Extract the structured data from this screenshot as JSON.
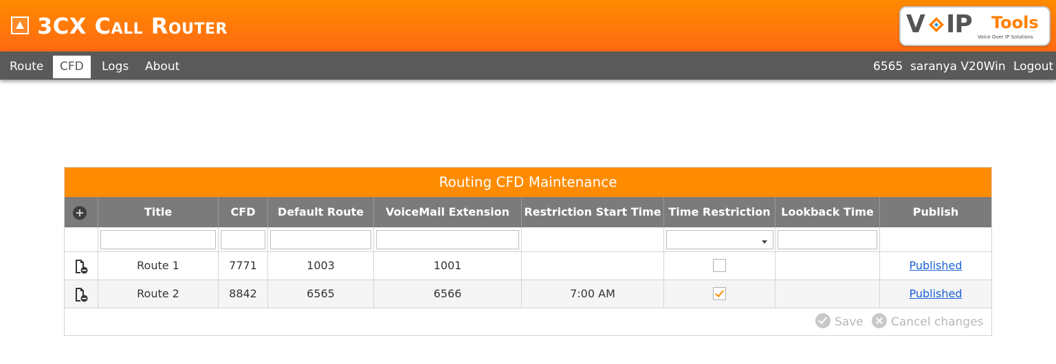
{
  "header": {
    "title": "3CX Call Router",
    "logo": {
      "part1": "V",
      "part2": "IP",
      "part3": "Tools",
      "tagline": "Voice Over IP Solutions"
    }
  },
  "nav": {
    "items": [
      {
        "label": "Route",
        "active": false
      },
      {
        "label": "CFD",
        "active": true
      },
      {
        "label": "Logs",
        "active": false
      },
      {
        "label": "About",
        "active": false
      }
    ],
    "user_info": "6565  saranya V20Win",
    "logout": "Logout"
  },
  "grid": {
    "title": "Routing CFD Maintenance",
    "columns": [
      "Title",
      "CFD",
      "Default Route",
      "VoiceMail Extension",
      "Restriction Start Time",
      "Time Restriction",
      "Lookback Time",
      "Publish"
    ],
    "rows": [
      {
        "title": "Route 1",
        "cfd": "7771",
        "default_route": "1003",
        "voicemail_extension": "1001",
        "restriction_start_time": "",
        "time_restriction": false,
        "lookback_time": "",
        "publish": "Published"
      },
      {
        "title": "Route 2",
        "cfd": "8842",
        "default_route": "6565",
        "voicemail_extension": "6566",
        "restriction_start_time": "7:00 AM",
        "time_restriction": true,
        "lookback_time": "",
        "publish": "Published"
      }
    ],
    "footer": {
      "save": "Save",
      "cancel": "Cancel changes"
    }
  },
  "colors": {
    "accent": "#ff8c00",
    "navbar": "#5a5a5a",
    "header_gray": "#7b7b7b",
    "link": "#1a5fd6"
  },
  "icons": [
    "collapse-icon",
    "add-icon",
    "delete-row-icon",
    "save-icon",
    "cancel-icon"
  ]
}
